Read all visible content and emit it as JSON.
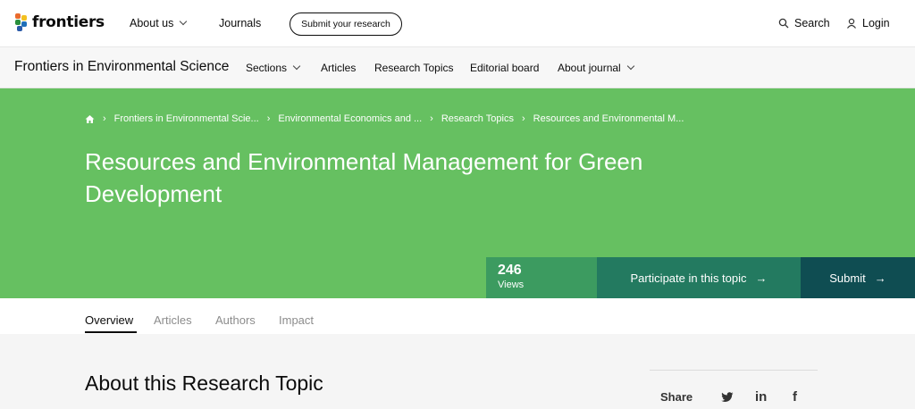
{
  "brand": {
    "name": "frontiers"
  },
  "topnav": {
    "about_us": "About us",
    "journals": "Journals",
    "submit_research": "Submit your research",
    "search": "Search",
    "login": "Login"
  },
  "journal": {
    "title": "Frontiers in Environmental Science",
    "nav": {
      "sections": "Sections",
      "articles": "Articles",
      "research_topics": "Research Topics",
      "editorial_board": "Editorial board",
      "about_journal": "About journal"
    }
  },
  "breadcrumb": [
    "Frontiers in Environmental Scie...",
    "Environmental Economics and ...",
    "Research Topics",
    "Resources and Environmental M..."
  ],
  "hero": {
    "title": "Resources and Environmental Management for Green Development",
    "views_count": "246",
    "views_label": "Views",
    "participate": "Participate in this topic",
    "submit": "Submit",
    "arrow": "→"
  },
  "tabs": [
    "Overview",
    "Articles",
    "Authors",
    "Impact"
  ],
  "content": {
    "about_title": "About this Research Topic",
    "share_label": "Share",
    "share_icons": {
      "twitter": "twitter-icon",
      "linkedin": "linkedin-icon",
      "facebook": "facebook-icon"
    }
  },
  "colors": {
    "hero_green": "#66c061",
    "views_bg": "#3c9b60",
    "participate_bg": "#237a60",
    "submit_bg": "#0f4d52"
  }
}
